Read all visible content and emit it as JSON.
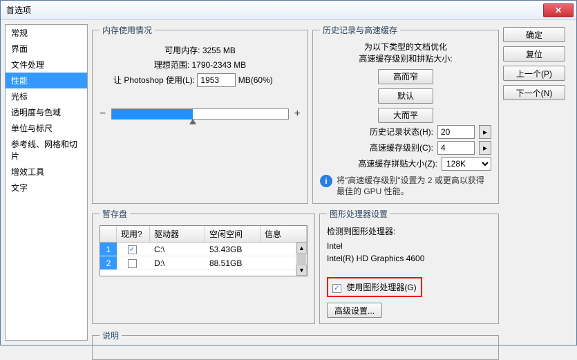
{
  "window": {
    "title": "首选项"
  },
  "sidebar": {
    "items": [
      {
        "label": "常规"
      },
      {
        "label": "界面"
      },
      {
        "label": "文件处理"
      },
      {
        "label": "性能",
        "selected": true
      },
      {
        "label": "光标"
      },
      {
        "label": "透明度与色域"
      },
      {
        "label": "单位与标尺"
      },
      {
        "label": "参考线、网格和切片"
      },
      {
        "label": "增效工具"
      },
      {
        "label": "文字"
      }
    ]
  },
  "memory": {
    "legend": "内存使用情况",
    "avail_label": "可用内存:",
    "avail_value": "3255 MB",
    "ideal_label": "理想范围:",
    "ideal_value": "1790-2343 MB",
    "let_label": "让 Photoshop 使用(L):",
    "let_value": "1953",
    "let_unit": "MB(60%)",
    "slider_pct": 60
  },
  "history": {
    "legend": "历史记录与高速缓存",
    "note_line1": "为以下类型的文档优化",
    "note_line2": "高速缓存级别和拼贴大小:",
    "btn_tall": "高而窄",
    "btn_default": "默认",
    "btn_big": "大而平",
    "states_label": "历史记录状态(H):",
    "states_value": "20",
    "levels_label": "高速缓存级别(C):",
    "levels_value": "4",
    "tile_label": "高速缓存拼贴大小(Z):",
    "tile_value": "128K",
    "tip": "将\"高速缓存级别\"设置为 2 或更高以获得最佳的 GPU 性能。"
  },
  "scratch": {
    "legend": "暂存盘",
    "headers": {
      "active": "现用?",
      "drive": "驱动器",
      "free": "空闲空间",
      "info": "信息"
    },
    "rows": [
      {
        "n": "1",
        "active": true,
        "drive": "C:\\",
        "free": "53.43GB"
      },
      {
        "n": "2",
        "active": false,
        "drive": "D:\\",
        "free": "88.51GB"
      }
    ]
  },
  "gpu": {
    "legend": "图形处理器设置",
    "detect_label": "检测到图形处理器:",
    "vendor": "Intel",
    "model": "Intel(R) HD Graphics 4600",
    "use_label": "使用图形处理器(G)",
    "use_checked": true,
    "adv_btn": "高级设置..."
  },
  "desc": {
    "legend": "说明"
  },
  "buttons": {
    "ok": "确定",
    "reset": "复位",
    "prev": "上一个(P)",
    "next": "下一个(N)"
  }
}
